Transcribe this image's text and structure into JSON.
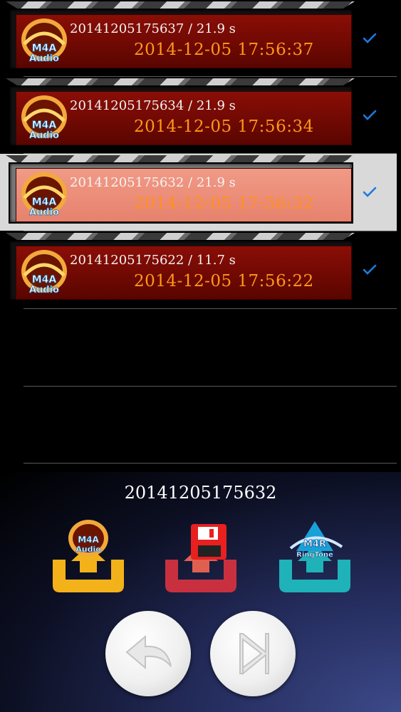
{
  "recordings": [
    {
      "title": "20141205175637 / 21.9 s",
      "date": "2014-12-05 17:56:37",
      "icon": "m4a-audio-icon",
      "checked": true
    },
    {
      "title": "20141205175634 / 21.9 s",
      "date": "2014-12-05 17:56:34",
      "icon": "m4a-audio-icon",
      "checked": true
    },
    {
      "title": "20141205175632 / 21.9 s",
      "date": "2014-12-05 17:56:32",
      "icon": "m4a-audio-icon",
      "checked": true,
      "selected": true
    },
    {
      "title": "20141205175622 / 11.7 s",
      "date": "2014-12-05 17:56:22",
      "icon": "m4a-audio-icon",
      "checked": true
    }
  ],
  "panel": {
    "current_name": "20141205175632",
    "actions": [
      {
        "name": "export-m4a-audio",
        "icon": "m4a-audio-icon",
        "color": "#f3b21a"
      },
      {
        "name": "save-file",
        "icon": "floppy-disk-icon",
        "color": "#c83040"
      },
      {
        "name": "export-m4r-ringtone",
        "icon": "m4r-ringtone-icon",
        "color": "#1fb2b8"
      }
    ],
    "controls": [
      {
        "name": "back",
        "icon": "back-arrow-icon"
      },
      {
        "name": "next",
        "icon": "skip-next-icon"
      }
    ]
  },
  "colors": {
    "card_red": "#7a0a04",
    "card_selected": "#ef927c",
    "date_orange": "#ff9818",
    "check_blue": "#1a7be0",
    "panel_blue": "#2a3470"
  }
}
